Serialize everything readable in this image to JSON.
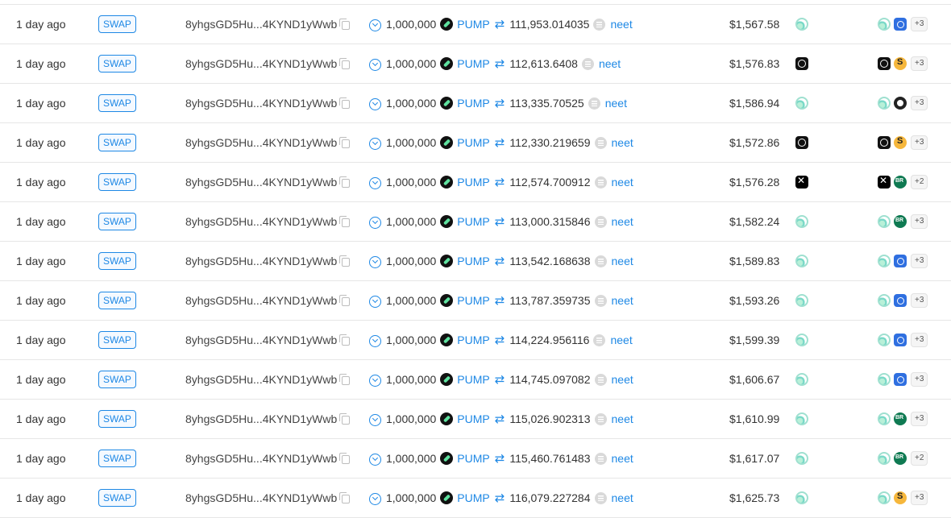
{
  "table": {
    "rows": [
      {
        "time": "1 day ago",
        "type": "SWAP",
        "signature": "8yhgsGD5Hu...4KYND1yWwb",
        "amount_in": "1,000,000",
        "token_in": "PUMP",
        "amount_out": "111,953.014035",
        "token_out": "neet",
        "value": "$1,567.58",
        "platform_icon": "wave-icon",
        "route_icons": [
          "wave-icon",
          "blue-shield-icon"
        ],
        "more": "+3"
      },
      {
        "time": "1 day ago",
        "type": "SWAP",
        "signature": "8yhgsGD5Hu...4KYND1yWwb",
        "amount_in": "1,000,000",
        "token_in": "PUMP",
        "amount_out": "112,613.6408",
        "token_out": "neet",
        "value": "$1,576.83",
        "platform_icon": "black-shield-icon",
        "route_icons": [
          "black-shield-icon",
          "orange-s-icon"
        ],
        "more": "+3"
      },
      {
        "time": "1 day ago",
        "type": "SWAP",
        "signature": "8yhgsGD5Hu...4KYND1yWwb",
        "amount_in": "1,000,000",
        "token_in": "PUMP",
        "amount_out": "113,335.70525",
        "token_out": "neet",
        "value": "$1,586.94",
        "platform_icon": "wave-icon",
        "route_icons": [
          "wave-icon",
          "dark-circle-icon"
        ],
        "more": "+3"
      },
      {
        "time": "1 day ago",
        "type": "SWAP",
        "signature": "8yhgsGD5Hu...4KYND1yWwb",
        "amount_in": "1,000,000",
        "token_in": "PUMP",
        "amount_out": "112,330.219659",
        "token_out": "neet",
        "value": "$1,572.86",
        "platform_icon": "black-shield-icon",
        "route_icons": [
          "black-shield-icon",
          "orange-s-icon"
        ],
        "more": "+3"
      },
      {
        "time": "1 day ago",
        "type": "SWAP",
        "signature": "8yhgsGD5Hu...4KYND1yWwb",
        "amount_in": "1,000,000",
        "token_in": "PUMP",
        "amount_out": "112,574.700912",
        "token_out": "neet",
        "value": "$1,576.28",
        "platform_icon": "dice-icon",
        "route_icons": [
          "dice-icon",
          "br-icon"
        ],
        "more": "+2"
      },
      {
        "time": "1 day ago",
        "type": "SWAP",
        "signature": "8yhgsGD5Hu...4KYND1yWwb",
        "amount_in": "1,000,000",
        "token_in": "PUMP",
        "amount_out": "113,000.315846",
        "token_out": "neet",
        "value": "$1,582.24",
        "platform_icon": "wave-icon",
        "route_icons": [
          "wave-icon",
          "br-icon"
        ],
        "more": "+3"
      },
      {
        "time": "1 day ago",
        "type": "SWAP",
        "signature": "8yhgsGD5Hu...4KYND1yWwb",
        "amount_in": "1,000,000",
        "token_in": "PUMP",
        "amount_out": "113,542.168638",
        "token_out": "neet",
        "value": "$1,589.83",
        "platform_icon": "wave-icon",
        "route_icons": [
          "wave-icon",
          "blue-shield-icon"
        ],
        "more": "+3"
      },
      {
        "time": "1 day ago",
        "type": "SWAP",
        "signature": "8yhgsGD5Hu...4KYND1yWwb",
        "amount_in": "1,000,000",
        "token_in": "PUMP",
        "amount_out": "113,787.359735",
        "token_out": "neet",
        "value": "$1,593.26",
        "platform_icon": "wave-icon",
        "route_icons": [
          "wave-icon",
          "blue-shield-icon"
        ],
        "more": "+3"
      },
      {
        "time": "1 day ago",
        "type": "SWAP",
        "signature": "8yhgsGD5Hu...4KYND1yWwb",
        "amount_in": "1,000,000",
        "token_in": "PUMP",
        "amount_out": "114,224.956116",
        "token_out": "neet",
        "value": "$1,599.39",
        "platform_icon": "wave-icon",
        "route_icons": [
          "wave-icon",
          "blue-shield-icon"
        ],
        "more": "+3"
      },
      {
        "time": "1 day ago",
        "type": "SWAP",
        "signature": "8yhgsGD5Hu...4KYND1yWwb",
        "amount_in": "1,000,000",
        "token_in": "PUMP",
        "amount_out": "114,745.097082",
        "token_out": "neet",
        "value": "$1,606.67",
        "platform_icon": "wave-icon",
        "route_icons": [
          "wave-icon",
          "blue-shield-icon"
        ],
        "more": "+3"
      },
      {
        "time": "1 day ago",
        "type": "SWAP",
        "signature": "8yhgsGD5Hu...4KYND1yWwb",
        "amount_in": "1,000,000",
        "token_in": "PUMP",
        "amount_out": "115,026.902313",
        "token_out": "neet",
        "value": "$1,610.99",
        "platform_icon": "wave-icon",
        "route_icons": [
          "wave-icon",
          "br-icon"
        ],
        "more": "+3"
      },
      {
        "time": "1 day ago",
        "type": "SWAP",
        "signature": "8yhgsGD5Hu...4KYND1yWwb",
        "amount_in": "1,000,000",
        "token_in": "PUMP",
        "amount_out": "115,460.761483",
        "token_out": "neet",
        "value": "$1,617.07",
        "platform_icon": "wave-icon",
        "route_icons": [
          "wave-icon",
          "br-icon"
        ],
        "more": "+2"
      },
      {
        "time": "1 day ago",
        "type": "SWAP",
        "signature": "8yhgsGD5Hu...4KYND1yWwb",
        "amount_in": "1,000,000",
        "token_in": "PUMP",
        "amount_out": "116,079.227284",
        "token_out": "neet",
        "value": "$1,625.73",
        "platform_icon": "wave-icon",
        "route_icons": [
          "wave-icon",
          "orange-s-icon"
        ],
        "more": "+3"
      }
    ]
  },
  "colors": {
    "accent": "#1e88e5",
    "divider": "#e6e6e6",
    "text": "#333333"
  }
}
